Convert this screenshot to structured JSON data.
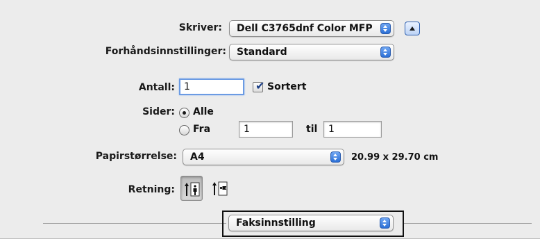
{
  "printer": {
    "label": "Skriver:",
    "value": "Dell C3765dnf Color MFP"
  },
  "presets": {
    "label": "Forhåndsinnstillinger:",
    "value": "Standard"
  },
  "copies": {
    "label": "Antall:",
    "value": "1",
    "collated_label": "Sortert",
    "collated_checked": true
  },
  "pages": {
    "label": "Sider:",
    "all_label": "Alle",
    "from_label": "Fra",
    "from_value": "1",
    "to_label": "til",
    "to_value": "1",
    "selected": "Alle"
  },
  "paper_size": {
    "label": "Papirstørrelse:",
    "value": "A4",
    "dimensions": "20.99 x 29.70 cm"
  },
  "orientation": {
    "label": "Retning:",
    "selected": "portrait"
  },
  "section_menu": {
    "value": "Faksinnstilling"
  },
  "colors": {
    "accent": "#2b6fd6",
    "panel_bg": "#ececec"
  }
}
